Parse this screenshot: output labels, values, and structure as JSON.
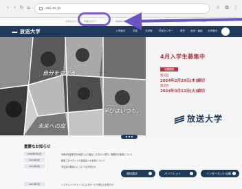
{
  "browser": {
    "url": "ouj.ac.jp",
    "nav_icons": [
      "back-icon",
      "forward-icon",
      "reload-icon",
      "home-icon"
    ],
    "toolbar_icons": [
      "star-icon",
      "extension-icon",
      "menu-icon"
    ]
  },
  "util_links": [
    "在学生の方へ",
    "卒業生の方へ",
    "教職員の方へ",
    "資料請求",
    "交通アクセス",
    "English"
  ],
  "site": {
    "logo": "放送大学",
    "nav": [
      "入学案内",
      "学部",
      "大学院",
      "学習センター",
      "研究",
      "放送・番組",
      "大学案内"
    ]
  },
  "hero": {
    "captions": [
      "自分を変える。",
      "学びはいつも。",
      "未来への扉"
    ],
    "promo_title": "4月入学生募集中",
    "tag": "出願期間",
    "period1_label": "第1回",
    "period1_date": "2024年2月29日(木)締切",
    "period2_label": "第2回",
    "period2_date": "2024年3月12日(火)締切",
    "brand": "放送大学"
  },
  "news": {
    "title": "重要なお知らせ",
    "items": [
      {
        "date": "2024年3月1日",
        "text": "令和6年能登半島地震により被災した方の入学料・授業料の免除について"
      },
      {
        "date": "2024年2月",
        "text": "新型コロナウイルス感染症への対応について"
      },
      {
        "date": "2024年2月",
        "text": "学生証の取扱いについてのお知らせ"
      },
      {
        "date": "2024年1月",
        "text": "システムメンテナンスによるサービス停止のお知らせ"
      }
    ]
  },
  "buttons": [
    "資料請求",
    "パンフレット",
    "インターネット出願"
  ],
  "colors": {
    "navy": "#1f3a5a",
    "accent_red": "#b23540",
    "annotation": "#6a53c2"
  }
}
